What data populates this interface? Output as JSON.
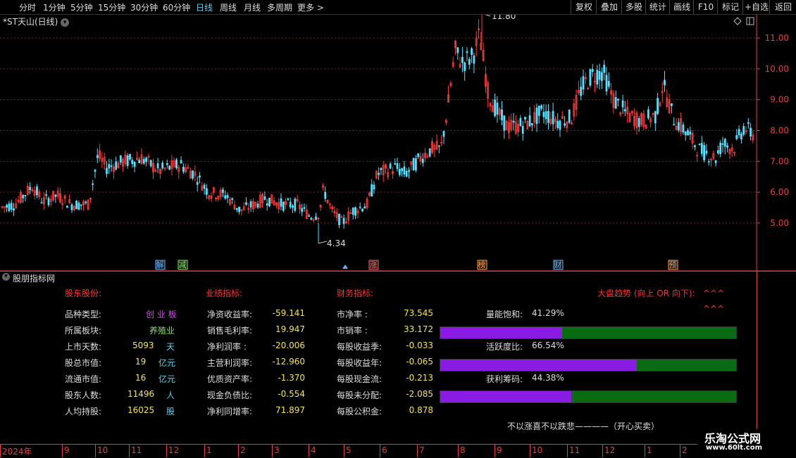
{
  "toolbar": {
    "left_items": [
      "分时",
      "1分钟",
      "5分钟",
      "15分钟",
      "30分钟",
      "60分钟",
      "日线",
      "周线",
      "月线",
      "多周期",
      "更多 >"
    ],
    "active_index": 6,
    "right_items": [
      "复权",
      "叠加",
      "多股",
      "统计",
      "画线",
      "F10",
      "标记",
      "+自选",
      "返回"
    ]
  },
  "chart": {
    "title": "*ST天山(日线)",
    "high_label": "11.80",
    "low_label": "4.34",
    "price_ticks": [
      "11.00",
      "10.00",
      "9.00",
      "8.00",
      "7.00",
      "6.00",
      "5.00"
    ],
    "event_markers": [
      "解",
      "减",
      "涨",
      "榜",
      "财",
      "预"
    ]
  },
  "panel": {
    "title": "股朋指标网",
    "section_headers": {
      "shareholder": "股东股份:",
      "performance": "业绩指标:",
      "finance": "财务指标:",
      "market_trend": "大盘趋势 (向上 OR 向下):",
      "trend_marks_1": "^^^",
      "trend_marks_2": "^^^"
    },
    "shareholder": [
      {
        "label": "品种类型:",
        "value": "创 业 板",
        "unit": ""
      },
      {
        "label": "所属板块:",
        "value": "养殖业",
        "unit": ""
      },
      {
        "label": "上市天数:",
        "value": "5093",
        "unit": "天"
      },
      {
        "label": "股总市值:",
        "value": "19",
        "unit": "亿元"
      },
      {
        "label": "流通市值:",
        "value": "16",
        "unit": "亿元"
      },
      {
        "label": "股东人数:",
        "value": "11496",
        "unit": "人"
      },
      {
        "label": "人均持股:",
        "value": "16025",
        "unit": "股"
      }
    ],
    "performance": [
      {
        "label": "净资收益率:",
        "value": "-59.141"
      },
      {
        "label": "销售毛利率:",
        "value": "19.947"
      },
      {
        "label": "净利润率  :",
        "value": "-20.006"
      },
      {
        "label": "主营利润率:",
        "value": "-12.960"
      },
      {
        "label": "优质资产率:",
        "value": "-1.370"
      },
      {
        "label": "现金负债比:",
        "value": "-0.554"
      },
      {
        "label": "净利同增率:",
        "value": "71.897"
      }
    ],
    "finance": [
      {
        "label": "市净率    :",
        "value": "73.545"
      },
      {
        "label": "市销率    :",
        "value": "33.172"
      },
      {
        "label": "每股收益季:",
        "value": "-0.033"
      },
      {
        "label": "每股收益年:",
        "value": "-0.065"
      },
      {
        "label": "每股现金流:",
        "value": "-0.213"
      },
      {
        "label": "每股未分配:",
        "value": "-2.085"
      },
      {
        "label": "每股公积金:",
        "value": "0.878"
      }
    ],
    "meters": [
      {
        "label": "量能饱和:",
        "value": "41.29%",
        "fraction": 0.4129
      },
      {
        "label": "活跃度比:",
        "value": "66.54%",
        "fraction": 0.6654
      },
      {
        "label": "获利筹码:",
        "value": "44.38%",
        "fraction": 0.4438
      }
    ],
    "motto": "不以涨喜不以跌悲————（开心买卖）"
  },
  "time_axis": [
    "2024年",
    "9",
    "10",
    "11",
    "12",
    "1",
    "2",
    "3",
    "4",
    "5",
    "6",
    "7",
    "8",
    "9",
    "10",
    "11",
    "12",
    "1",
    "2"
  ],
  "watermark": {
    "line1": "乐淘公式网",
    "line2": "www.60lt.com"
  }
}
